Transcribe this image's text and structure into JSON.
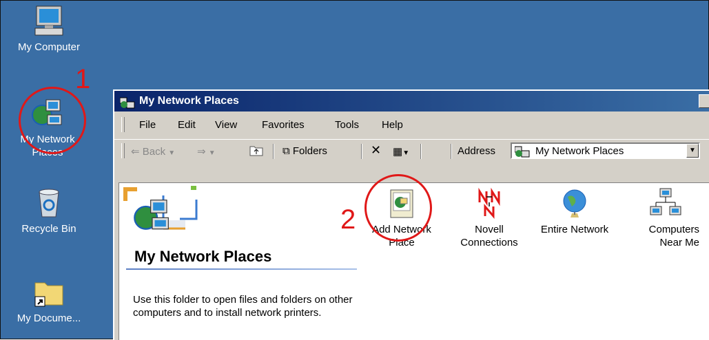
{
  "desktop": {
    "icons": [
      {
        "label": "My Computer",
        "icon": "my-computer-icon"
      },
      {
        "label": "My Network Places",
        "icon": "network-places-icon"
      },
      {
        "label": "Recycle Bin",
        "icon": "recycle-bin-icon"
      },
      {
        "label": "My Docume...",
        "icon": "folder-shortcut-icon"
      }
    ],
    "annotations": [
      "1",
      "2"
    ],
    "colors": {
      "desktop": "#3a6ea5",
      "annotation": "#e01818"
    }
  },
  "window": {
    "title": "My Network Places",
    "menu": [
      "File",
      "Edit",
      "View",
      "Favorites",
      "Tools",
      "Help"
    ],
    "toolbar": {
      "back": "Back",
      "folders": "Folders",
      "address_label": "Address",
      "address_value": "My Network Places"
    },
    "content": {
      "heading": "My Network Places",
      "description": "Use this folder to open files and folders on other computers and to install network printers.",
      "items": [
        {
          "label": "Add Network Place",
          "icon": "add-network-place-icon"
        },
        {
          "label": "Novell Connections",
          "icon": "novell-icon"
        },
        {
          "label": "Entire Network",
          "icon": "globe-icon"
        },
        {
          "label": "Computers Near Me",
          "icon": "computers-near-me-icon"
        }
      ]
    }
  }
}
